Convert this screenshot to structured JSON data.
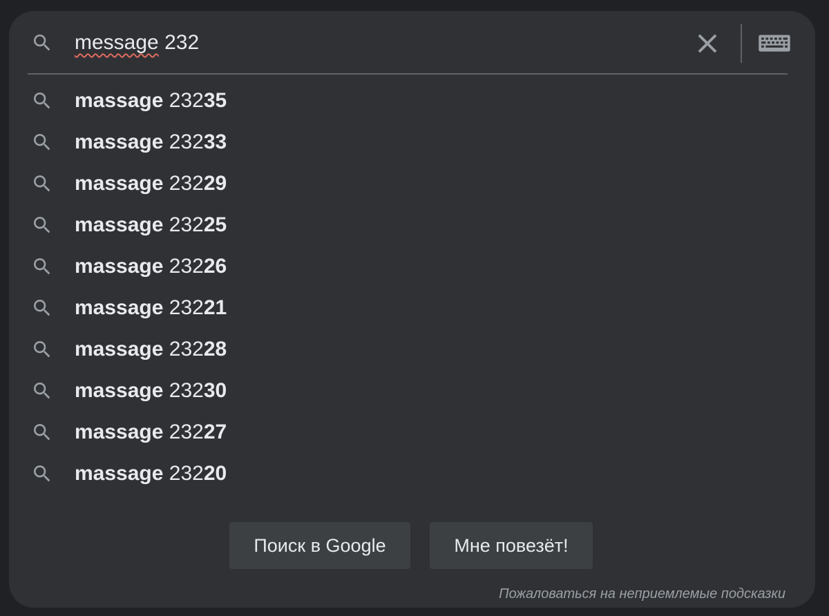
{
  "search": {
    "query_misspelled": "message",
    "query_rest": " 232",
    "icon": "search-icon",
    "clear_icon": "close-icon",
    "keyboard_icon": "keyboard-icon"
  },
  "suggestions": [
    {
      "prefix": "massage",
      "typed": " 232",
      "completion": "35"
    },
    {
      "prefix": "massage",
      "typed": " 232",
      "completion": "33"
    },
    {
      "prefix": "massage",
      "typed": " 232",
      "completion": "29"
    },
    {
      "prefix": "massage",
      "typed": " 232",
      "completion": "25"
    },
    {
      "prefix": "massage",
      "typed": " 232",
      "completion": "26"
    },
    {
      "prefix": "massage",
      "typed": " 232",
      "completion": "21"
    },
    {
      "prefix": "massage",
      "typed": " 232",
      "completion": "28"
    },
    {
      "prefix": "massage",
      "typed": " 232",
      "completion": "30"
    },
    {
      "prefix": "massage",
      "typed": " 232",
      "completion": "27"
    },
    {
      "prefix": "massage",
      "typed": " 232",
      "completion": "20"
    }
  ],
  "buttons": {
    "search_label": "Поиск в Google",
    "lucky_label": "Мне повезёт!"
  },
  "footer": {
    "report_label": "Пожаловаться на неприемлемые подсказки"
  },
  "colors": {
    "background": "#202124",
    "panel": "#303134",
    "text": "#e8eaed",
    "icon": "#9aa0a6",
    "divider": "#5f6368",
    "button": "#3c4043",
    "spellcheck_underline": "#e06c5f"
  }
}
